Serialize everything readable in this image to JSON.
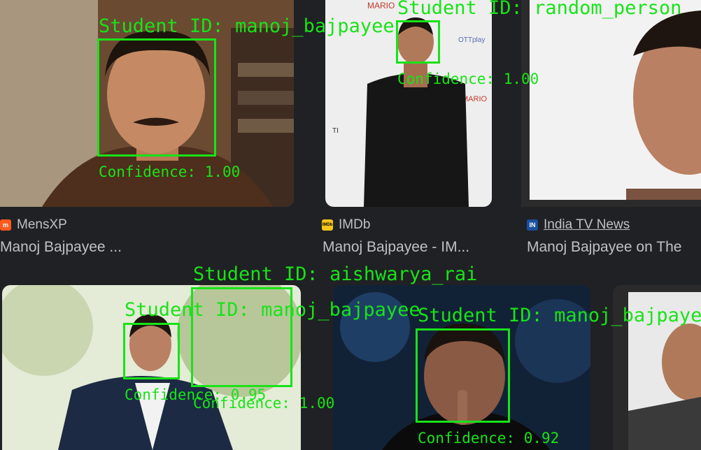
{
  "results": [
    {
      "source": "MensXP",
      "title": "Manoj Bajpayee ...",
      "favicon": "mensxp-icon"
    },
    {
      "source": "IMDb",
      "title": "Manoj Bajpayee - IM...",
      "favicon": "imdb-icon",
      "favicon_text": "IMDb"
    },
    {
      "source": "India TV News",
      "title": "Manoj Bajpayee on The",
      "favicon": "indiatv-icon",
      "favicon_text": "IN"
    }
  ],
  "detections": [
    {
      "label": "Student ID: manoj_bajpayee",
      "confidence": "Confidence: 1.00"
    },
    {
      "label": "Student ID: random_person",
      "confidence": "Confidence: 1.00"
    },
    {
      "label": "Student ID: aishwarya_rai",
      "confidence": "Confidence: 1.00"
    },
    {
      "label": "Student ID: manoj_bajpayee",
      "confidence": "Confidence: 0.95"
    },
    {
      "label": "Student ID: manoj_bajpayee",
      "confidence": "Confidence: 0.92"
    }
  ],
  "colors": {
    "overlay": "#18e318",
    "background": "#202124",
    "text": "#bdc1c6"
  }
}
